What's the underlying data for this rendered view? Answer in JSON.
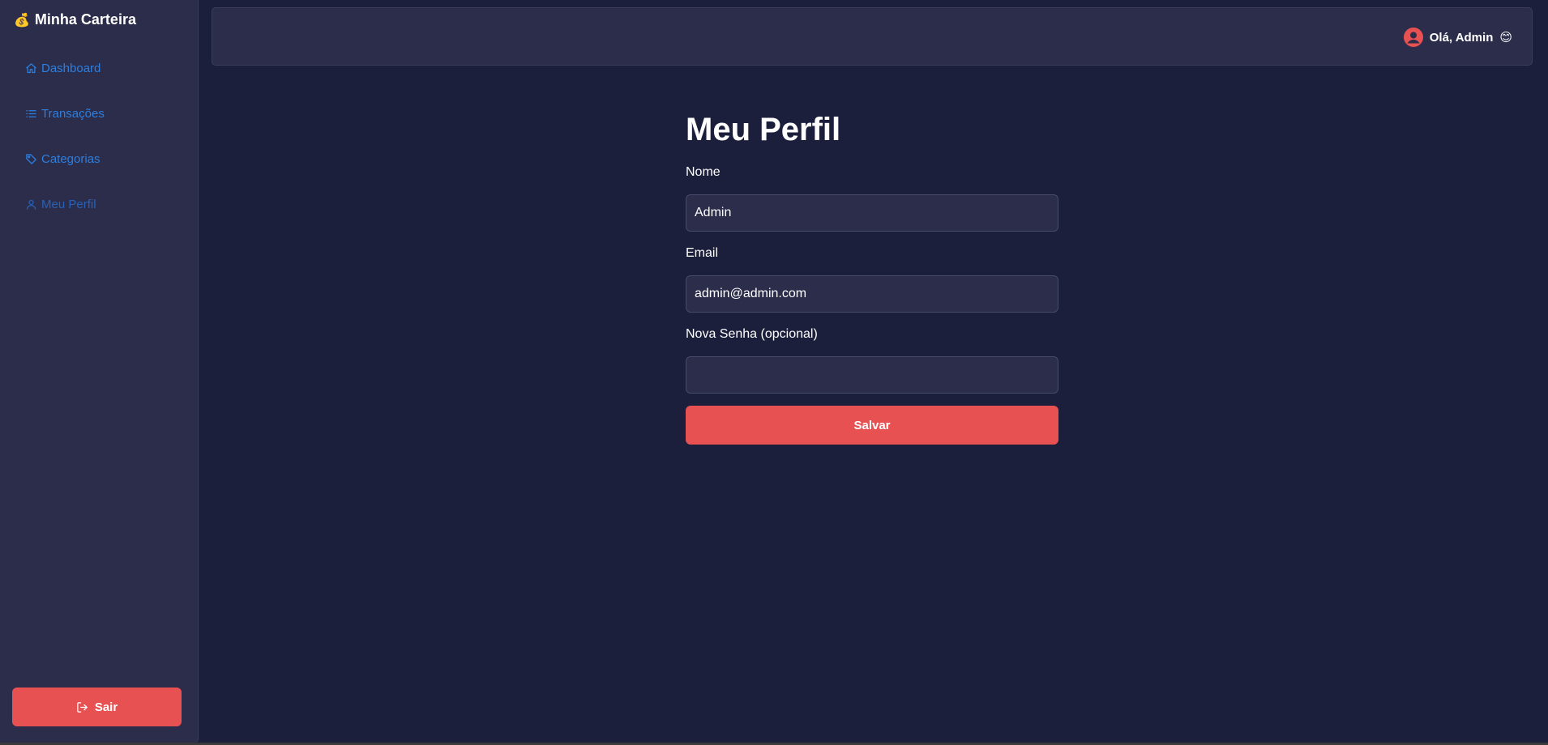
{
  "sidebar": {
    "brand": {
      "emoji": "💰",
      "title": "Minha Carteira"
    },
    "items": [
      {
        "label": "Dashboard",
        "icon": "home-icon"
      },
      {
        "label": "Transações",
        "icon": "list-icon"
      },
      {
        "label": "Categorias",
        "icon": "tag-icon"
      },
      {
        "label": "Meu Perfil",
        "icon": "user-icon"
      }
    ],
    "logout_label": "Sair"
  },
  "header": {
    "greeting": "Olá, Admin",
    "greeting_emoji": "😊"
  },
  "main": {
    "title": "Meu Perfil",
    "fields": {
      "name": {
        "label": "Nome",
        "value": "Admin"
      },
      "email": {
        "label": "Email",
        "value": "admin@admin.com"
      },
      "password": {
        "label": "Nova Senha (opcional)",
        "value": ""
      }
    },
    "save_label": "Salvar"
  },
  "colors": {
    "background": "#1c1f3b",
    "panel": "#2b2d4b",
    "accent_red": "#e85151",
    "link_blue": "#2d7fe0"
  }
}
